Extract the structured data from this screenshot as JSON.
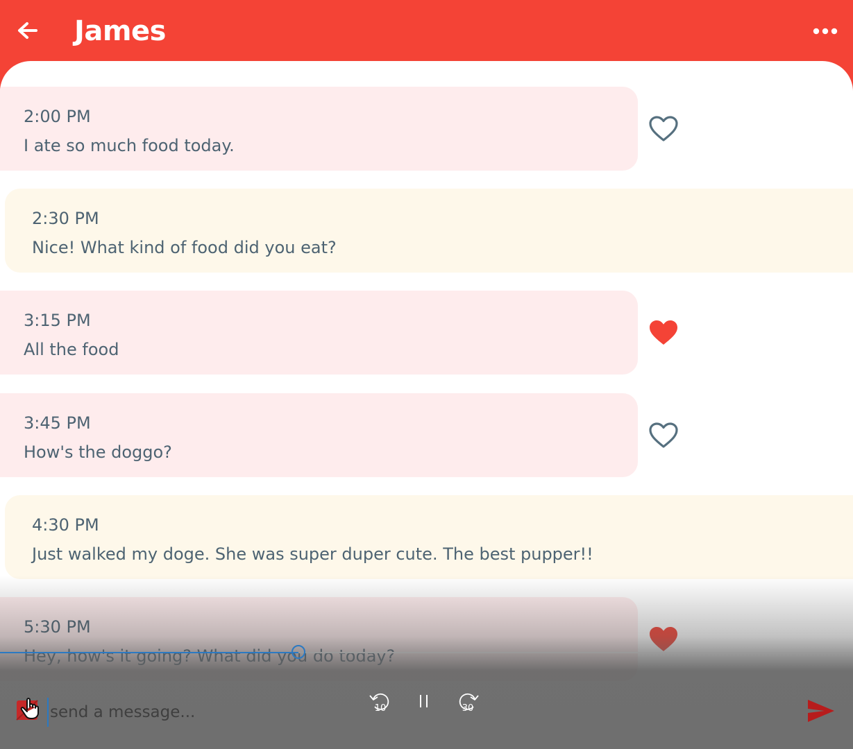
{
  "header": {
    "title": "James",
    "back_icon": "arrow-left-icon",
    "menu_icon": "more-horizontal-icon"
  },
  "colors": {
    "accent": "#f44336",
    "incoming_bubble": "#feeced",
    "outgoing_bubble": "#fef8ea",
    "text": "#4d6372",
    "heart_outline": "#56707f",
    "heart_filled": "#f44336",
    "player_accent": "#2b79c2"
  },
  "messages": [
    {
      "time": "2:00 PM",
      "text": "I ate so much food today.",
      "direction": "incoming",
      "liked": false
    },
    {
      "time": "2:30 PM",
      "text": "Nice! What kind of food did you eat?",
      "direction": "outgoing",
      "liked": null
    },
    {
      "time": "3:15 PM",
      "text": "All the food",
      "direction": "incoming",
      "liked": true
    },
    {
      "time": "3:45 PM",
      "text": "How's the doggo?",
      "direction": "incoming",
      "liked": false
    },
    {
      "time": "4:30 PM",
      "text": "Just walked my doge. She was super duper cute. The best pupper!!",
      "direction": "outgoing",
      "liked": null
    },
    {
      "time": "5:30 PM",
      "text": "Hey, how's it going? What did you do today?",
      "direction": "incoming",
      "liked": true
    }
  ],
  "composer": {
    "placeholder": "send a message...",
    "value": "",
    "attach_icon": "attach-icon",
    "send_icon": "send-icon"
  },
  "media_controls": {
    "seek_back_label": "10",
    "seek_forward_label": "30",
    "pause_icon": "pause-icon",
    "progress_fraction": 0.35
  }
}
